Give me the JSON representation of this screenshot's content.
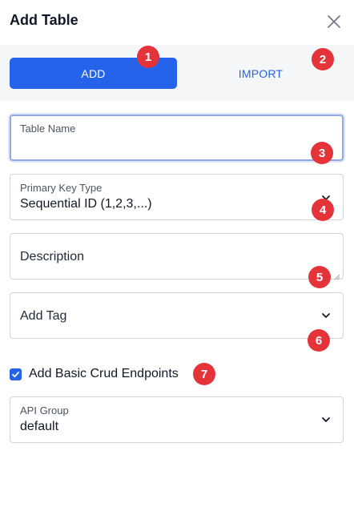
{
  "header": {
    "title": "Add Table",
    "close_icon": "close-icon"
  },
  "tabs": {
    "add_label": "ADD",
    "import_label": "IMPORT",
    "active": "ADD",
    "accent_color": "#2563eb"
  },
  "form": {
    "table_name": {
      "label": "Table Name",
      "value": ""
    },
    "primary_key_type": {
      "label": "Primary Key Type",
      "value": "Sequential ID (1,2,3,...)",
      "icon": "chevron-down-icon"
    },
    "description": {
      "placeholder": "Description",
      "value": ""
    },
    "tag": {
      "placeholder": "Add Tag",
      "icon": "chevron-down-icon"
    },
    "crud_endpoints": {
      "label": "Add Basic Crud Endpoints",
      "checked": true
    },
    "api_group": {
      "label": "API Group",
      "value": "default",
      "icon": "chevron-down-icon"
    }
  },
  "badges": [
    "1",
    "2",
    "3",
    "4",
    "5",
    "6",
    "7"
  ],
  "badge_color": "#e5333a"
}
